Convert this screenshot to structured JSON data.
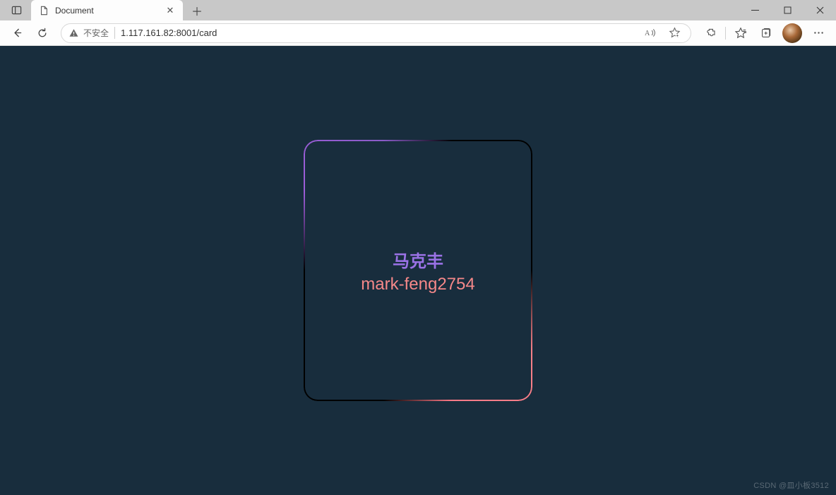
{
  "browser": {
    "tab": {
      "title": "Document"
    },
    "security_label": "不安全",
    "url": "1.117.161.82:8001/card"
  },
  "card": {
    "name": "马克丰",
    "handle": "mark-feng2754"
  },
  "watermark": "CSDN @皿小板3512"
}
